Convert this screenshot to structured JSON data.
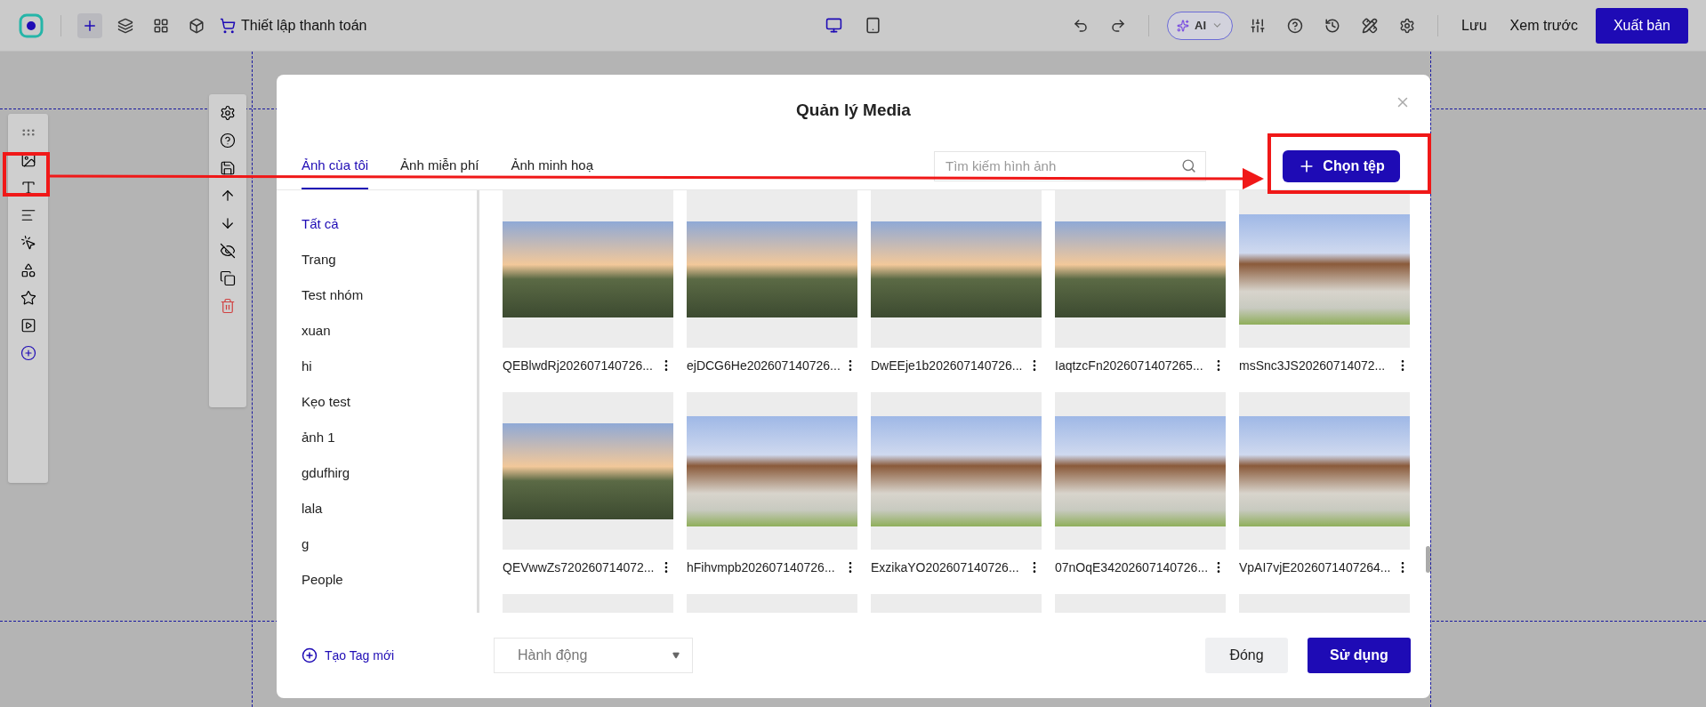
{
  "topbar": {
    "title": "Thiết lập thanh toán",
    "devices": [
      {
        "kind": "desktop",
        "selected": true
      },
      {
        "kind": "tablet",
        "selected": false
      }
    ],
    "ai_label": "AI",
    "save": "Lưu",
    "preview": "Xem trước",
    "publish": "Xuất bản"
  },
  "dialog": {
    "title": "Quản lý Media",
    "tabs": [
      {
        "label": "Ảnh của tôi",
        "selected": true
      },
      {
        "label": "Ảnh miễn phí",
        "selected": false
      },
      {
        "label": "Ảnh minh hoạ",
        "selected": false
      }
    ],
    "search": {
      "placeholder": "Tìm kiếm hình ảnh"
    },
    "upload_button": "Chọn tệp",
    "tags": [
      {
        "label": "Tất cả",
        "selected": true
      },
      {
        "label": "Trang",
        "selected": false
      },
      {
        "label": "Test nhóm",
        "selected": false
      },
      {
        "label": "xuan",
        "selected": false
      },
      {
        "label": "hi",
        "selected": false
      },
      {
        "label": "Kẹo test",
        "selected": false
      },
      {
        "label": "ảnh 1",
        "selected": false
      },
      {
        "label": "gdufhirg",
        "selected": false
      },
      {
        "label": "lala",
        "selected": false
      },
      {
        "label": "g",
        "selected": false
      },
      {
        "label": "People",
        "selected": false
      }
    ],
    "new_tag": "Tạo Tag mới",
    "tiles": [
      {
        "kind": "garden",
        "name": "QEBlwdRj202607140726..."
      },
      {
        "kind": "garden",
        "name": "ejDCG6He202607140726..."
      },
      {
        "kind": "garden",
        "name": "DwEEje1b202607140726..."
      },
      {
        "kind": "garden",
        "name": "IaqtzcFn2026071407265..."
      },
      {
        "kind": "building",
        "name": "msSnc3JS20260714072..."
      },
      {
        "kind": "garden",
        "name": "QEVwwZs720260714072..."
      },
      {
        "kind": "building",
        "name": "hFihvmpb202607140726..."
      },
      {
        "kind": "building",
        "name": "ExzikaYO202607140726..."
      },
      {
        "kind": "building",
        "name": "07nOqE34202607140726..."
      },
      {
        "kind": "building",
        "name": "VpAI7vjE2026071407264..."
      },
      {
        "kind": "cut"
      },
      {
        "kind": "cut"
      },
      {
        "kind": "cut"
      },
      {
        "kind": "cut"
      },
      {
        "kind": "cut"
      }
    ],
    "action_select": {
      "placeholder": "Hành động"
    },
    "close_button": "Đóng",
    "use_button": "Sử dụng"
  }
}
